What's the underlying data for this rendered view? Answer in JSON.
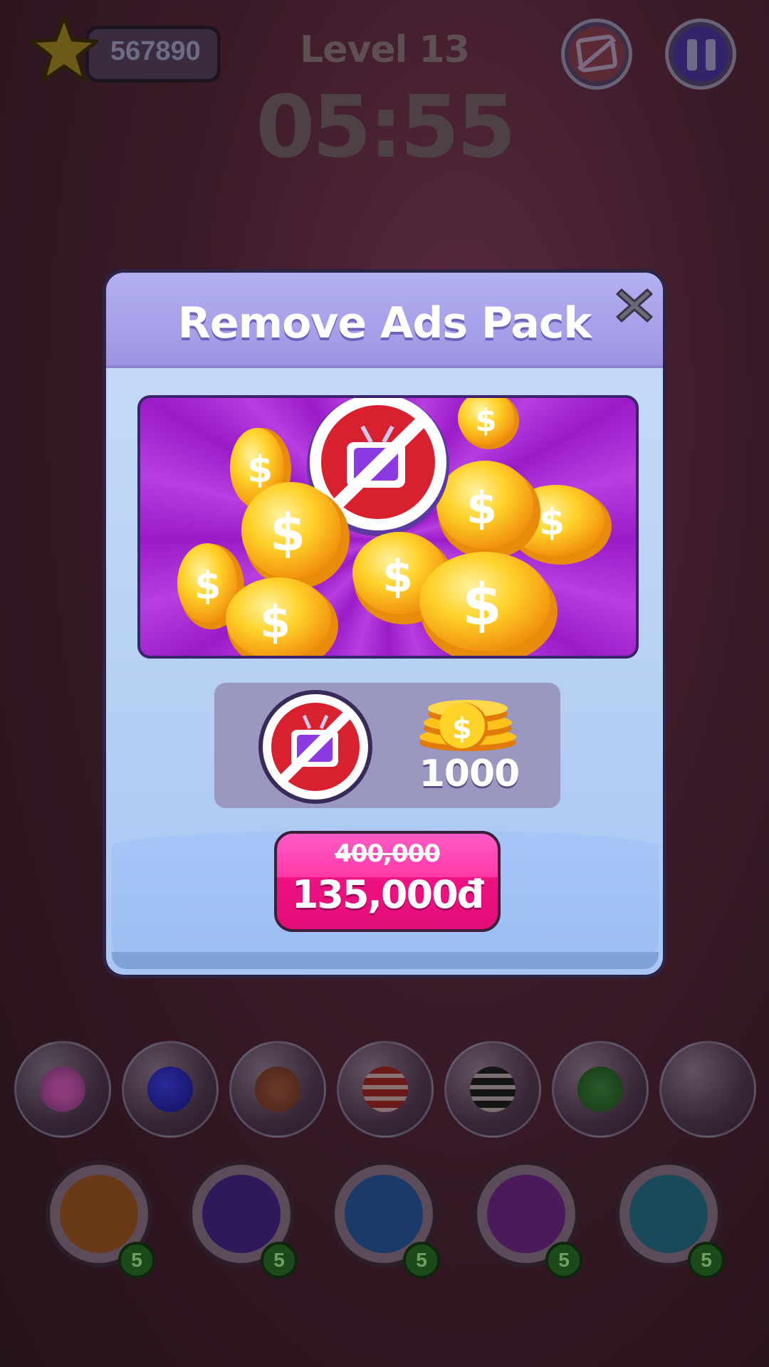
{
  "hud": {
    "score": "567890",
    "level": "Level 13",
    "timer": "05:55"
  },
  "tray": {
    "bubbles": [
      "pink-dotted-ball",
      "blue-ball",
      "orange-dotted-ball",
      "red-striped-ball",
      "black-striped-ball",
      "green-dotted-ball",
      "empty"
    ]
  },
  "powerups": [
    {
      "name": "hint-bulb",
      "count": "5"
    },
    {
      "name": "undo",
      "count": "5"
    },
    {
      "name": "shuffle",
      "count": "5"
    },
    {
      "name": "swap",
      "count": "5"
    },
    {
      "name": "freeze-time",
      "count": "5"
    }
  ],
  "dialog": {
    "title": "Remove Ads Pack",
    "reward_coins": "1000",
    "old_price": "400,000",
    "new_price": "135,000đ"
  },
  "colors": {
    "dialog_header": "#a49ee8",
    "dialog_body": "#b6d0f4",
    "buy_button": "#ff3aa8",
    "hero_bg": "#9a1cc8",
    "coin": "#ffc21a"
  }
}
